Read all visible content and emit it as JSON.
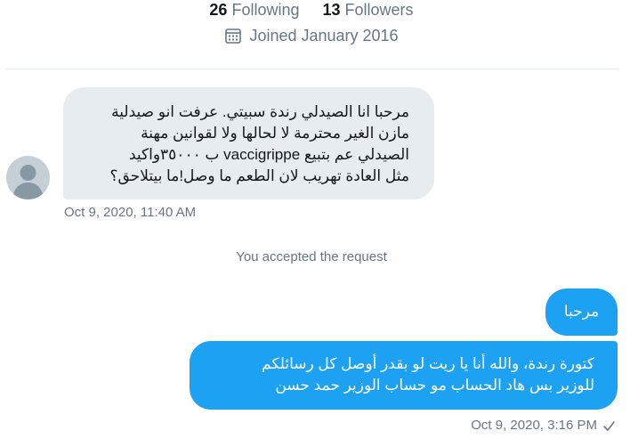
{
  "profile": {
    "following_count": "26",
    "following_label": "Following",
    "followers_count": "13",
    "followers_label": "Followers",
    "joined_text": "Joined January 2016"
  },
  "conversation": {
    "received_message": {
      "lines": [
        "مرحبا انا الصيدلي رندة سبيتي. عرفت انو صيدلية",
        "مازن الغير محترمة لا لحالها ولا لقوانين مهنة",
        "الصيدلي عم بتبيع vaccigrippe ب ٣٥٠٠٠واكيد",
        "مثل العادة تهريب لان الطعم ما وصل!ما بيتلاحق؟"
      ],
      "timestamp": "Oct 9, 2020, 11:40 AM"
    },
    "system_message": "You accepted the request",
    "sent_messages": [
      {
        "lines": [
          "مرحبا"
        ]
      },
      {
        "lines": [
          "كتورة رندة، والله أنا يا ريت لو بقدر أوصل كل رسائلكم",
          "للوزير بس هاد الحساب مو حساب الوزير حمد حسن"
        ]
      }
    ],
    "sent_timestamp": "Oct 9, 2020, 3:16 PM"
  },
  "colors": {
    "accent": "#1da1f2",
    "received_bubble": "#e6ecf0",
    "secondary_text": "#657786"
  },
  "icons": {
    "joined": "calendar-icon",
    "delivered": "checkmark-icon",
    "avatar": "default-avatar-icon"
  }
}
